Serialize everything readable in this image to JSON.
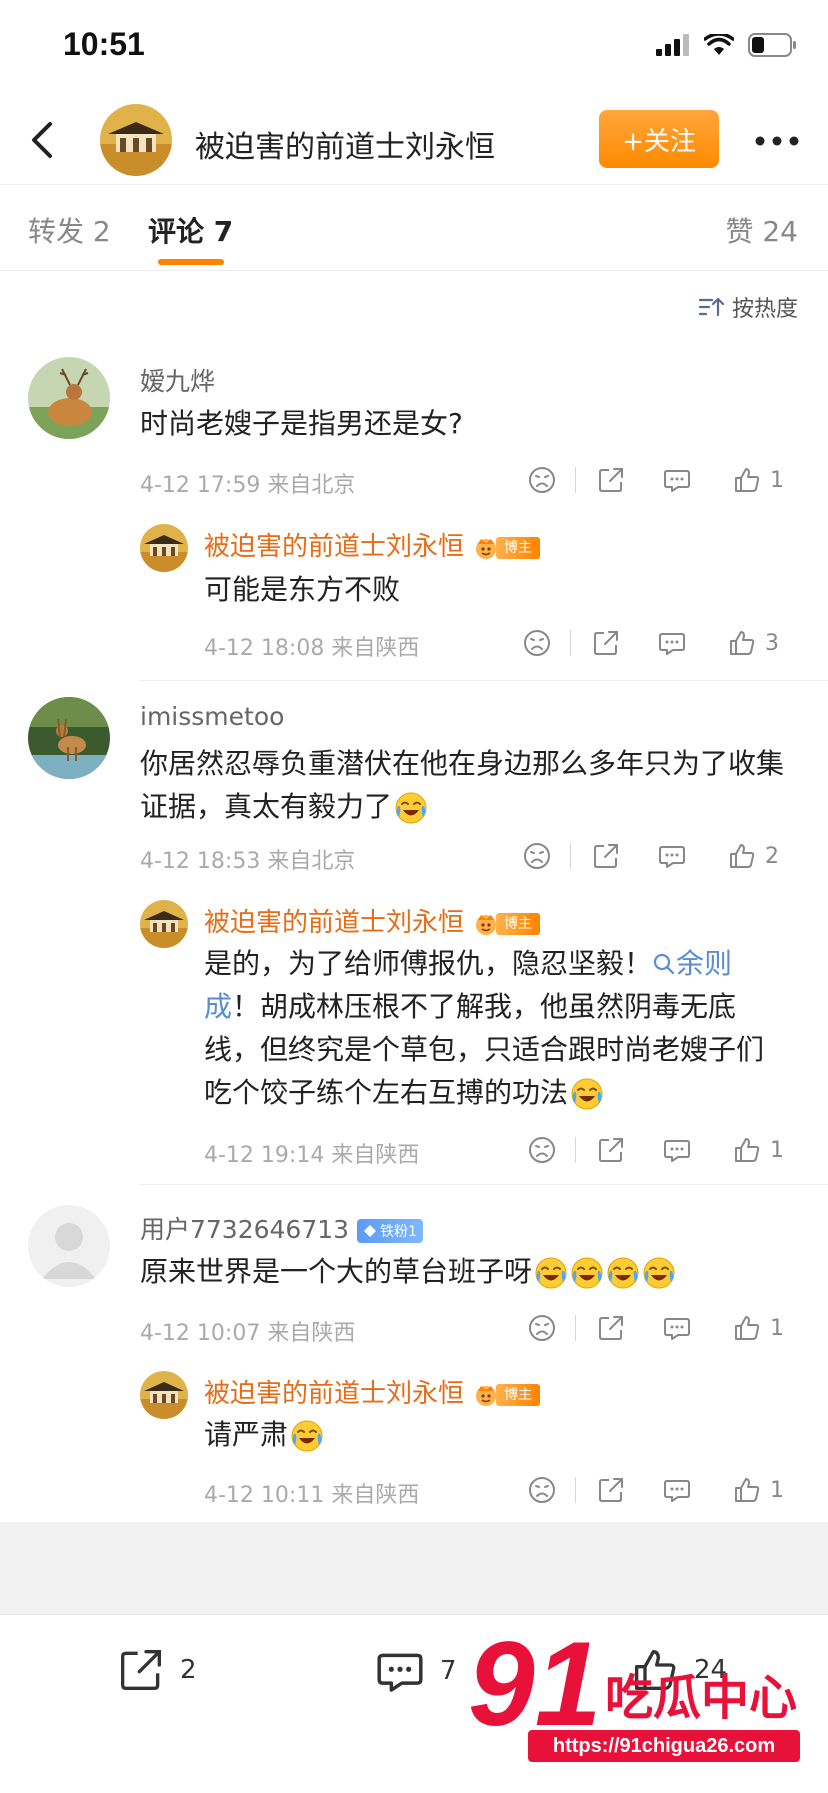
{
  "status_bar": {
    "time": "10:51"
  },
  "nav": {
    "title": "被迫害的前道士刘永恒",
    "follow_label": "+关注"
  },
  "tabs": [
    {
      "label": "转发 2"
    },
    {
      "label": "评论 7"
    },
    {
      "label": "赞 24"
    }
  ],
  "sort_label": "按热度",
  "comments": [
    {
      "user": "嫒九烨",
      "text": "时尚老嫂子是指男还是女?",
      "meta": "4-12 17:59  来自北京",
      "likes": "1",
      "reply": {
        "user": "被迫害的前道士刘永恒",
        "badge": "博主",
        "text": "可能是东方不败",
        "meta": "4-12 18:08  来自陕西",
        "likes": "3"
      }
    },
    {
      "user": "imissmetoo",
      "text": "你居然忍辱负重潜伏在他在身边那么多年只为了收集证据，真太有毅力了",
      "meta": "4-12 18:53  来自北京",
      "likes": "2",
      "reply": {
        "user": "被迫害的前道士刘永恒",
        "badge": "博主",
        "text_before": "是的，为了给师傅报仇，隐忍坚毅！",
        "link": "余则成",
        "text_after": "！胡成林压根不了解我，他虽然阴毒无底线，但终究是个草包，只适合跟时尚老嫂子们吃个饺子练个左右互搏的功法",
        "meta": "4-12 19:14  来自陕西",
        "likes": "1"
      }
    },
    {
      "user": "用户7732646713",
      "badge": "铁粉1",
      "text": "原来世界是一个大的草台班子呀",
      "meta": "4-12 10:07  来自陕西",
      "likes": "1",
      "reply": {
        "user": "被迫害的前道士刘永恒",
        "badge": "博主",
        "text": "请严肃",
        "meta": "4-12 10:11  来自陕西",
        "likes": "1"
      }
    }
  ],
  "bottom_bar": {
    "repost_count": "2",
    "comment_count": "7",
    "like_count": "24"
  },
  "watermark": {
    "number": "91",
    "text": "吃瓜中心",
    "url": "https://91chigua26.com"
  },
  "colors": {
    "accent": "#ff8200",
    "username_orange": "#e86c16",
    "link": "#5b8bd6",
    "watermark_red": "#e8113a"
  },
  "icons": [
    "back-icon",
    "more-icon",
    "sort-icon",
    "dislike-icon",
    "share-icon",
    "comment-icon",
    "like-icon",
    "laugh-cry-emoji",
    "crown-icon",
    "search-link-icon"
  ]
}
